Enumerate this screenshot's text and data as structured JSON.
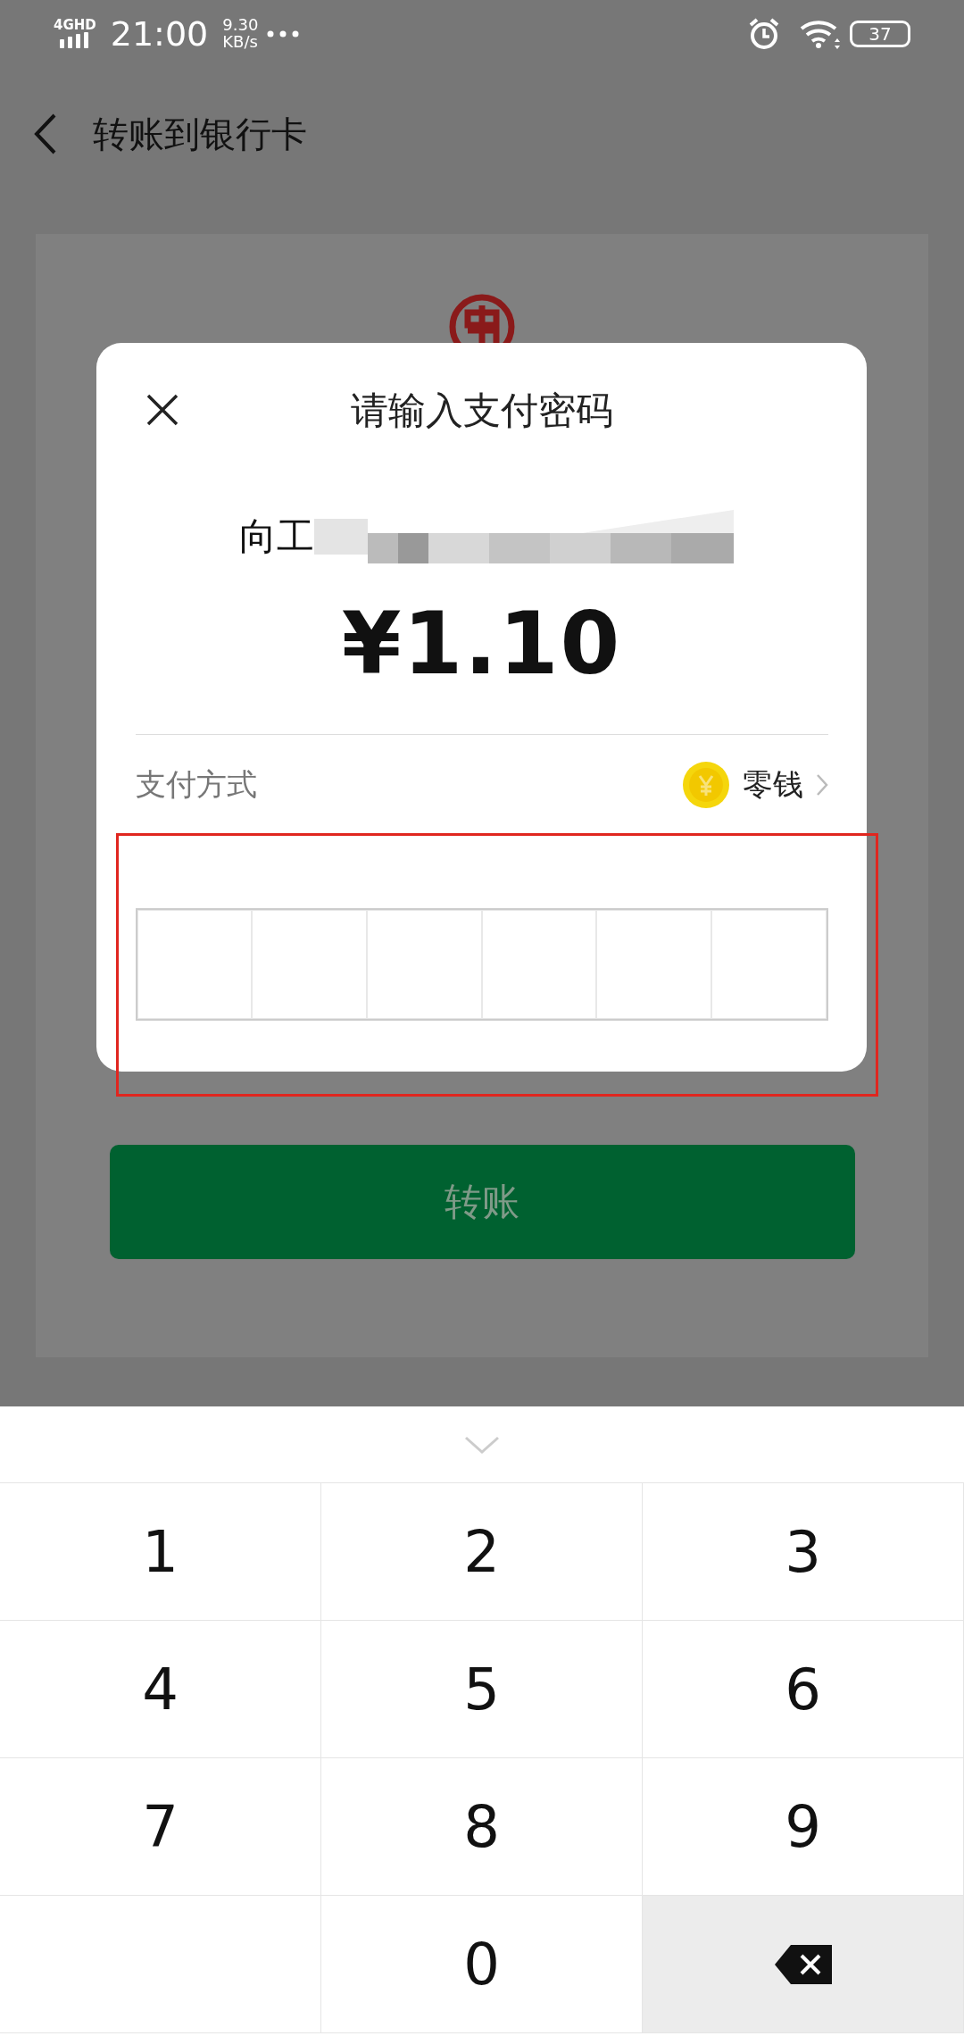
{
  "status_bar": {
    "network": "4GHD",
    "time": "21:00",
    "speed": "9.30",
    "speed_unit": "KB/s",
    "battery": "37"
  },
  "header": {
    "title": "转账到银行卡"
  },
  "dialog": {
    "title": "请输入支付密码",
    "recipient": "向工",
    "amount": "¥1.10",
    "payment_label": "支付方式",
    "payment_method": "零钱",
    "pin_cells": [
      {
        "filled": false
      },
      {
        "filled": false
      },
      {
        "filled": false
      },
      {
        "filled": false
      },
      {
        "filled": false
      },
      {
        "filled": false
      }
    ]
  },
  "transfer_button": {
    "label": "转账",
    "disabled": true
  },
  "keypad": {
    "keys": [
      {
        "kind": "digit",
        "label": "1"
      },
      {
        "kind": "digit",
        "label": "2"
      },
      {
        "kind": "digit",
        "label": "3"
      },
      {
        "kind": "digit",
        "label": "4"
      },
      {
        "kind": "digit",
        "label": "5"
      },
      {
        "kind": "digit",
        "label": "6"
      },
      {
        "kind": "digit",
        "label": "7"
      },
      {
        "kind": "digit",
        "label": "8"
      },
      {
        "kind": "digit",
        "label": "9"
      },
      {
        "kind": "blank"
      },
      {
        "kind": "digit",
        "label": "0"
      },
      {
        "kind": "delete"
      }
    ]
  }
}
